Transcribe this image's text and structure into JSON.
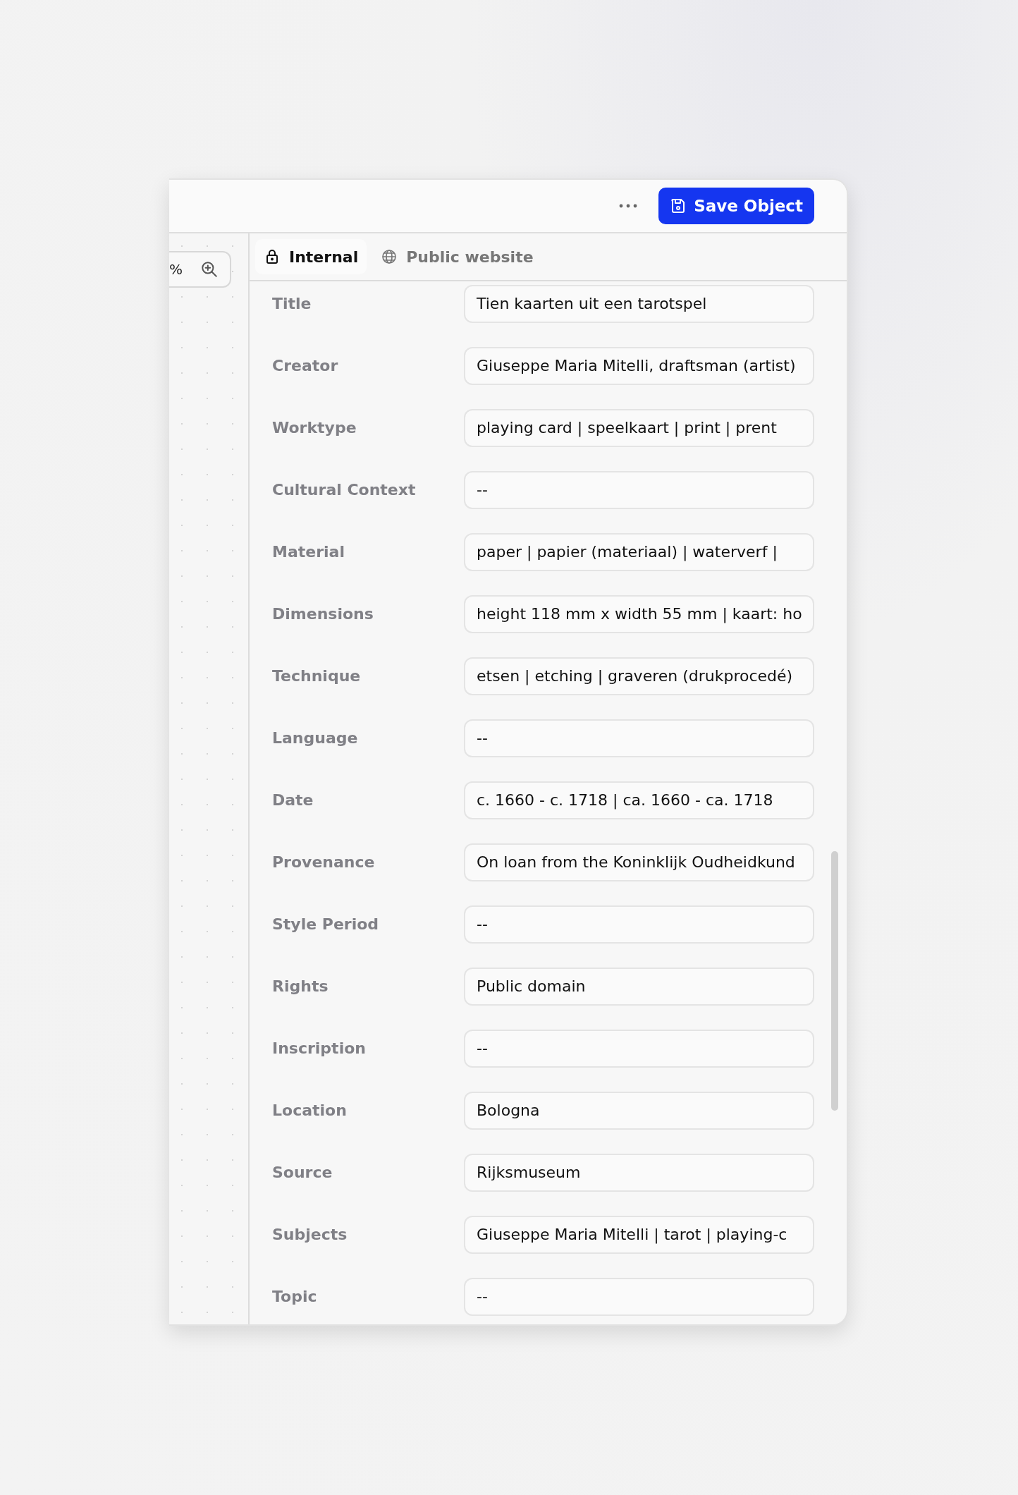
{
  "toolbar": {
    "save_button": "Save Object"
  },
  "canvas": {
    "zoom_reading": "%"
  },
  "tabs": [
    {
      "label": "Internal",
      "kind": "private",
      "selected": true
    },
    {
      "label": "Public website",
      "kind": "public",
      "selected": false
    }
  ],
  "fields": [
    {
      "label": "Title",
      "value": "Tien kaarten uit een tarotspel"
    },
    {
      "label": "Creator",
      "value": "Giuseppe Maria Mitelli, draftsman (artist)"
    },
    {
      "label": "Worktype",
      "value": "playing card | speelkaart | print | prent"
    },
    {
      "label": "Cultural Context",
      "value": "--"
    },
    {
      "label": "Material",
      "value": "paper | papier (materiaal) | waterverf |"
    },
    {
      "label": "Dimensions",
      "value": "height 118 mm x width 55 mm | kaart: ho"
    },
    {
      "label": "Technique",
      "value": "etsen | etching | graveren (drukprocedé)"
    },
    {
      "label": "Language",
      "value": "--"
    },
    {
      "label": "Date",
      "value": "c. 1660 - c. 1718 | ca. 1660 - ca. 1718"
    },
    {
      "label": "Provenance",
      "value": "On loan from the Koninklijk Oudheidkund"
    },
    {
      "label": "Style Period",
      "value": "--"
    },
    {
      "label": "Rights",
      "value": "Public domain"
    },
    {
      "label": "Inscription",
      "value": "--"
    },
    {
      "label": "Location",
      "value": "Bologna"
    },
    {
      "label": "Source",
      "value": "Rijksmuseum"
    },
    {
      "label": "Subjects",
      "value": "Giuseppe Maria Mitelli | tarot | playing-c"
    },
    {
      "label": "Topic",
      "value": "--"
    }
  ]
}
